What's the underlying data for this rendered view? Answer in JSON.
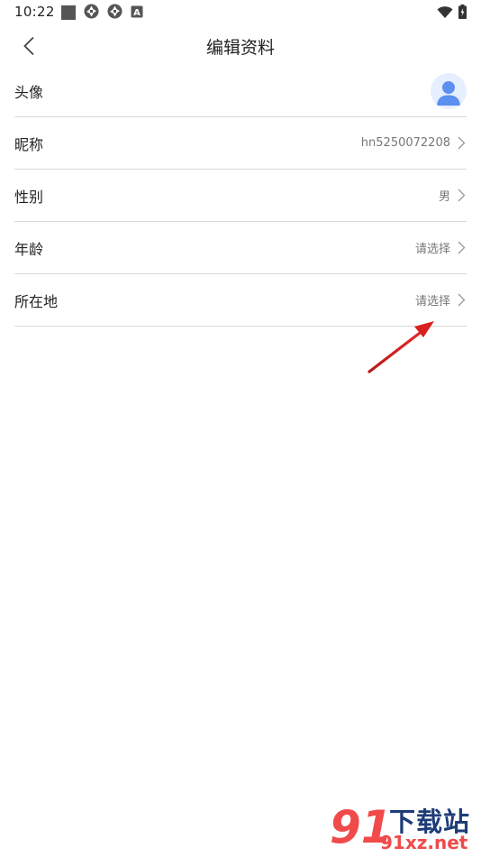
{
  "status_bar": {
    "time": "10:22",
    "notif_letter": "A"
  },
  "header": {
    "title": "编辑资料"
  },
  "rows": [
    {
      "label": "头像",
      "value": ""
    },
    {
      "label": "昵称",
      "value": "hn5250072208"
    },
    {
      "label": "性别",
      "value": "男"
    },
    {
      "label": "年龄",
      "value": "请选择"
    },
    {
      "label": "所在地",
      "value": "请选择"
    }
  ],
  "watermark": {
    "number": "91",
    "text": "下载站",
    "domain": "91xz.net"
  },
  "colors": {
    "annotation_arrow": "#d92020",
    "avatar_figure": "#5b8ff0",
    "watermark_red": "#f04a4a",
    "watermark_blue": "#1e3c78"
  }
}
